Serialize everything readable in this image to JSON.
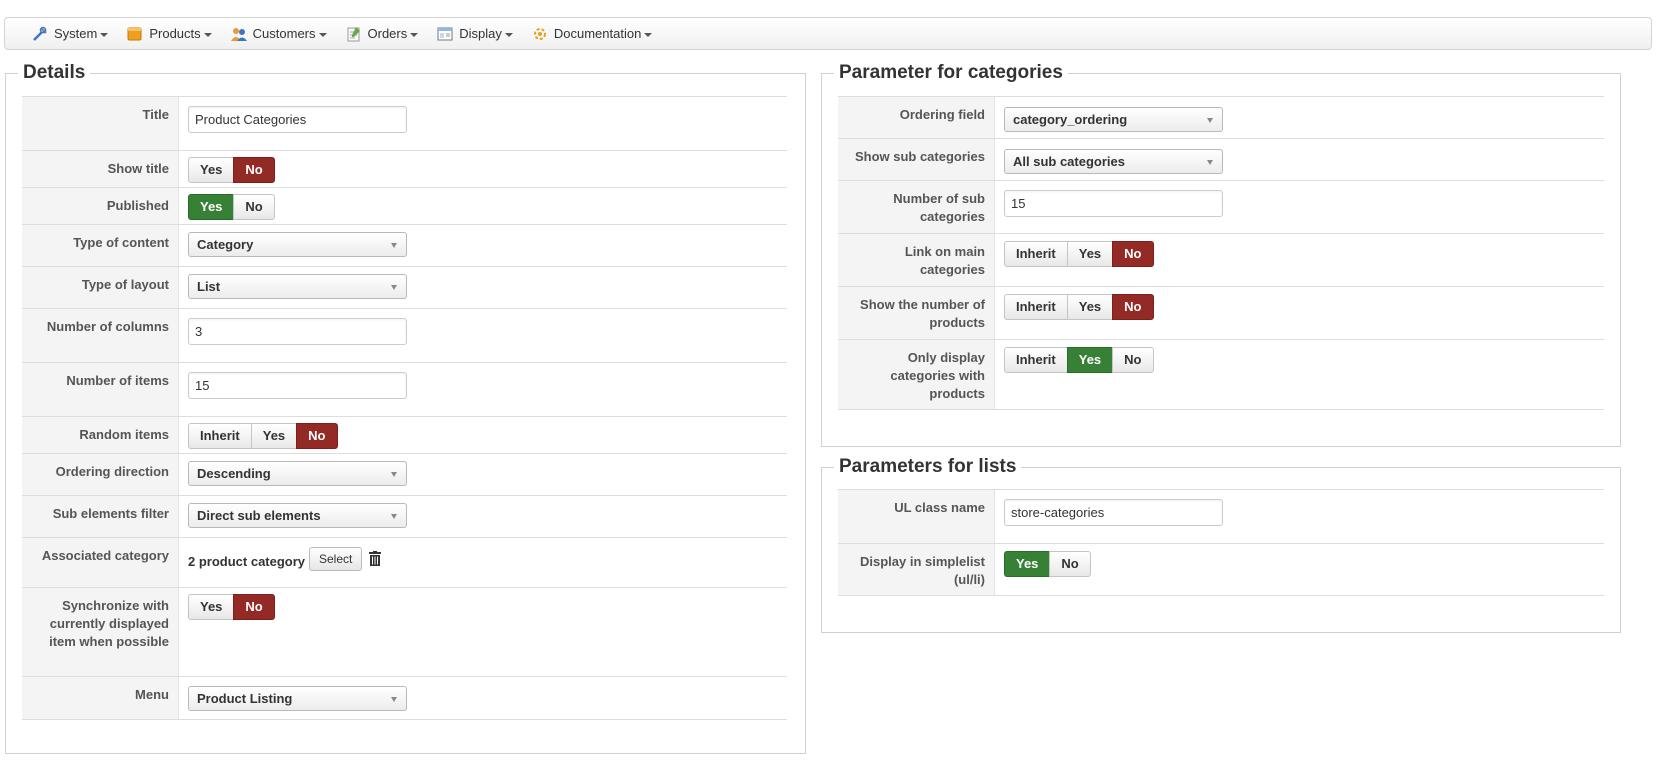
{
  "menu": [
    {
      "label": "System",
      "icon": "tools-icon"
    },
    {
      "label": "Products",
      "icon": "products-icon"
    },
    {
      "label": "Customers",
      "icon": "customers-icon"
    },
    {
      "label": "Orders",
      "icon": "orders-icon"
    },
    {
      "label": "Display",
      "icon": "display-icon"
    },
    {
      "label": "Documentation",
      "icon": "documentation-icon"
    }
  ],
  "details": {
    "legend": "Details",
    "title_label": "Title",
    "title_value": "Product Categories",
    "show_title_label": "Show title",
    "published_label": "Published",
    "type_content_label": "Type of content",
    "type_content_value": "Category",
    "type_layout_label": "Type of layout",
    "type_layout_value": "List",
    "num_columns_label": "Number of columns",
    "num_columns_value": "3",
    "num_items_label": "Number of items",
    "num_items_value": "15",
    "random_items_label": "Random items",
    "ordering_direction_label": "Ordering direction",
    "ordering_direction_value": "Descending",
    "sub_filter_label": "Sub elements filter",
    "sub_filter_value": "Direct sub elements",
    "assoc_category_label": "Associated category",
    "assoc_category_value": "2 product category",
    "select_label": "Select",
    "sync_label": "Synchronize with currently displayed item when possible",
    "menu_label": "Menu",
    "menu_value": "Product Listing"
  },
  "toggles": {
    "yes": "Yes",
    "no": "No",
    "inherit": "Inherit"
  },
  "categories": {
    "legend": "Parameter for categories",
    "ordering_field_label": "Ordering field",
    "ordering_field_value": "category_ordering",
    "show_sub_label": "Show sub categories",
    "show_sub_value": "All sub categories",
    "num_sub_label": "Number of sub categories",
    "num_sub_value": "15",
    "link_main_label": "Link on main categories",
    "show_num_products_label": "Show the number of products",
    "only_display_label": "Only display categories with products"
  },
  "lists": {
    "legend": "Parameters for lists",
    "ul_class_label": "UL class name",
    "ul_class_value": "store-categories",
    "simplelist_label": "Display in simplelist (ul/li)"
  },
  "colors": {
    "yes_active": "#378137",
    "no_active": "#942a25"
  }
}
